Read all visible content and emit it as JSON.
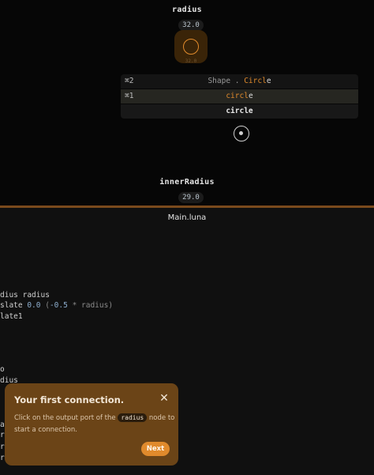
{
  "graph": {
    "radius_node": {
      "name": "radius",
      "value": "32.0",
      "sub_value": "32.0"
    },
    "searcher": {
      "results": [
        {
          "hotkey": "⌘2",
          "prefix": "Shape . ",
          "match": "Circl",
          "rest": "e"
        },
        {
          "hotkey": "⌘1",
          "prefix": "",
          "match": "circl",
          "rest": "e"
        }
      ],
      "input": "circle"
    },
    "inner_radius_node": {
      "name": "innerRadius",
      "value": "29.0"
    }
  },
  "editor": {
    "file_name": "Main.luna",
    "code_lines": [
      {
        "a": "dius radius",
        "n1": "",
        "b": "",
        "n2": "",
        "c": ""
      },
      {
        "a": "slate ",
        "n1": "0.0",
        "b": " (",
        "n2": "-0.5",
        "c": " * radius)"
      },
      {
        "a": "late1",
        "n1": "",
        "b": "",
        "n2": "",
        "c": ""
      },
      {
        "a": "o",
        "n1": "",
        "b": "",
        "n2": "",
        "c": ""
      },
      {
        "a": "dius",
        "n1": "",
        "b": "",
        "n2": "",
        "c": ""
      },
      {
        "a": "a",
        "n1": "",
        "b": "",
        "n2": "",
        "c": ""
      },
      {
        "a": "r",
        "n1": "",
        "b": "",
        "n2": "",
        "c": ""
      },
      {
        "a": "r",
        "n1": "",
        "b": "",
        "n2": "",
        "c": ""
      },
      {
        "a": "r",
        "n1": "",
        "b": "",
        "n2": "",
        "c": ""
      }
    ]
  },
  "popup": {
    "title": "Your first connection.",
    "close_icon": "close-icon",
    "body_before": "Click on the output port of the ",
    "body_code": "radius",
    "body_after": " node to start a connection.",
    "next_label": "Next"
  },
  "colors": {
    "accent": "#e08a2c",
    "popup_bg": "#6b4417",
    "separator": "#7a4a1c",
    "background": "#060606"
  }
}
